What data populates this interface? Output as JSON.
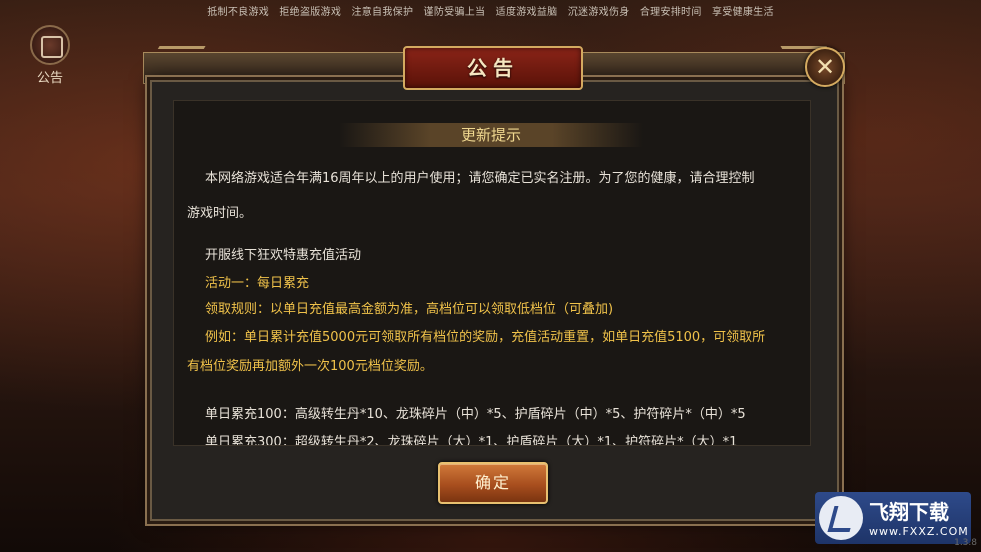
{
  "top_notice": "抵制不良游戏　拒绝盗版游戏　注意自我保护　谨防受骗上当　适度游戏益脑　沉迷游戏伤身　合理安排时间　享受健康生活",
  "side_button": {
    "label": "公告",
    "icon": "announcement-icon"
  },
  "dialog": {
    "title": "公告",
    "close_glyph": "✕",
    "section_header": "更新提示",
    "intro_line1": "本网络游戏适合年满16周年以上的用户使用；请您确定已实名注册。为了您的健康，请合理控制",
    "intro_line2": "游戏时间。",
    "event_title": "开服线下狂欢特惠充值活动",
    "activity_one": "活动一：每日累充",
    "rule": "领取规则：以单日充值最高金额为准，高档位可以领取低档位（可叠加)",
    "example_line1": "例如：单日累计充值5000元可领取所有档位的奖励，充值活动重置，如单日充值5100，可领取所",
    "example_line2": "有档位奖励再加额外一次100元档位奖励。",
    "tier_100": "单日累充100：高级转生丹*10、龙珠碎片（中）*5、护盾碎片（中）*5、护符碎片*（中）*5",
    "tier_300": "单日累充300：超级转生丹*2、龙珠碎片（大）*1、护盾碎片（大）*1、护符碎片*（大）*1",
    "confirm_label": "确定"
  },
  "watermark": {
    "brand": "飞翔下载",
    "url": "www.FXXZ.COM"
  },
  "version": "1.3.8",
  "colors": {
    "highlight": "#f0c24a",
    "body_text": "#e8e2d8",
    "title_plate": "#8a2418"
  }
}
